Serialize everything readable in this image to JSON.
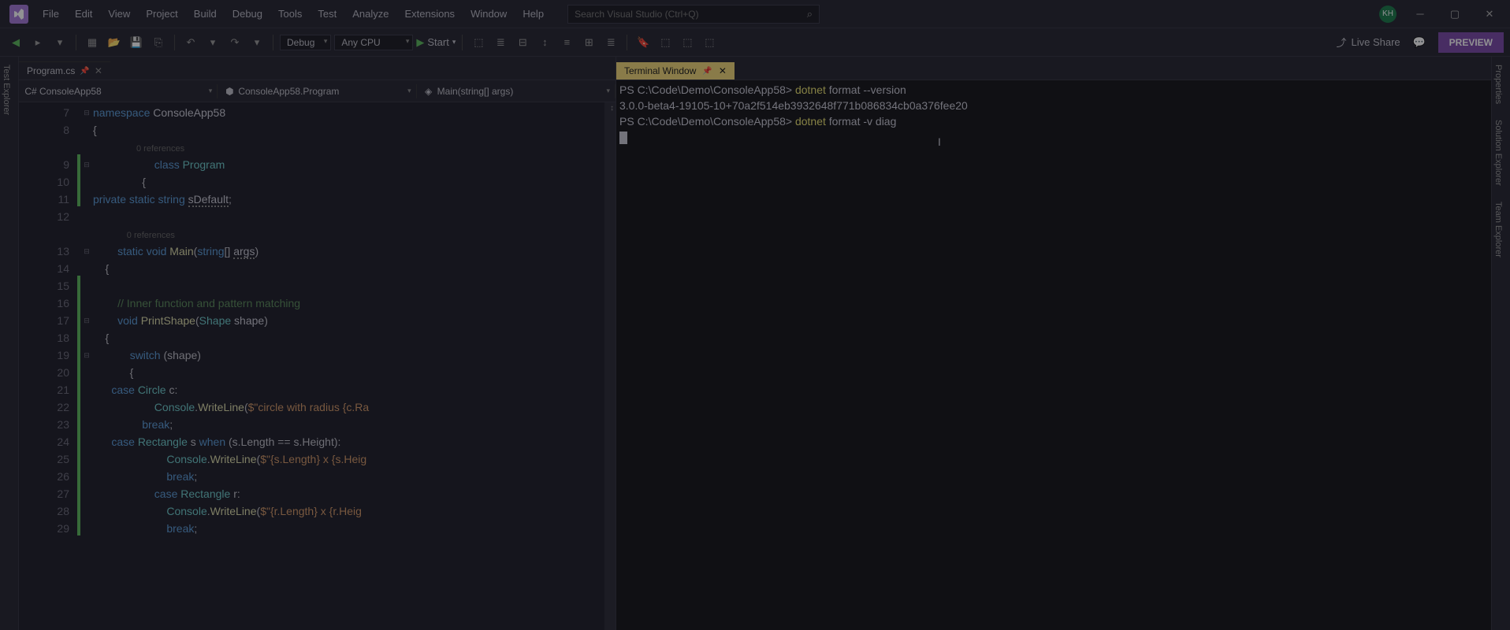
{
  "menu": {
    "items": [
      "File",
      "Edit",
      "View",
      "Project",
      "Build",
      "Debug",
      "Tools",
      "Test",
      "Analyze",
      "Extensions",
      "Window",
      "Help"
    ]
  },
  "search": {
    "placeholder": "Search Visual Studio (Ctrl+Q)"
  },
  "avatar": {
    "initials": "KH"
  },
  "toolbar": {
    "config": "Debug",
    "platform": "Any CPU",
    "start": "Start",
    "live_share": "Live Share",
    "preview": "PREVIEW"
  },
  "side_tabs": {
    "left": "Test Explorer",
    "right": [
      "Properties",
      "Solution Explorer",
      "Team Explorer"
    ]
  },
  "editor": {
    "file_tab": "Program.cs",
    "breadcrumb": {
      "project": "ConsoleApp58",
      "class": "ConsoleApp58.Program",
      "method": "Main(string[] args)"
    },
    "lines": [
      {
        "n": 7,
        "fold": "-",
        "change": false,
        "parts": [
          [
            "kw",
            "namespace"
          ],
          [
            "",
            " "
          ],
          [
            "ident",
            "ConsoleApp58"
          ]
        ]
      },
      {
        "n": 8,
        "change": false,
        "parts": [
          [
            "",
            "{"
          ]
        ]
      },
      {
        "ref": "0 references",
        "indent": 18
      },
      {
        "n": 9,
        "fold": "-",
        "change": true,
        "parts": [
          [
            "",
            "                    "
          ],
          [
            "kw",
            "class"
          ],
          [
            "",
            " "
          ],
          [
            "type",
            "Program"
          ]
        ]
      },
      {
        "n": 10,
        "change": true,
        "parts": [
          [
            "",
            "                {"
          ]
        ]
      },
      {
        "n": 11,
        "change": true,
        "parts": [
          [
            "kw",
            "private"
          ],
          [
            "",
            " "
          ],
          [
            "kw",
            "static"
          ],
          [
            "",
            " "
          ],
          [
            "kw",
            "string"
          ],
          [
            "",
            " "
          ],
          [
            "ident squiggle",
            "sDefault"
          ],
          [
            "",
            ";"
          ]
        ]
      },
      {
        "n": 12,
        "change": false,
        "parts": [
          [
            "",
            " "
          ]
        ]
      },
      {
        "ref": "0 references",
        "indent": 14
      },
      {
        "n": 13,
        "fold": "-",
        "change": false,
        "parts": [
          [
            "",
            "        "
          ],
          [
            "kw",
            "static"
          ],
          [
            "",
            " "
          ],
          [
            "kw",
            "void"
          ],
          [
            "",
            " "
          ],
          [
            "method",
            "Main"
          ],
          [
            "",
            "("
          ],
          [
            "kw",
            "string"
          ],
          [
            "",
            "[] "
          ],
          [
            "ident squiggle",
            "args"
          ],
          [
            "",
            ")"
          ]
        ]
      },
      {
        "n": 14,
        "change": false,
        "parts": [
          [
            "",
            "    {"
          ]
        ]
      },
      {
        "n": 15,
        "change": true,
        "parts": [
          [
            "",
            " "
          ]
        ]
      },
      {
        "n": 16,
        "change": true,
        "parts": [
          [
            "",
            "        "
          ],
          [
            "comment",
            "// Inner function and pattern matching"
          ]
        ]
      },
      {
        "n": 17,
        "fold": "-",
        "change": true,
        "parts": [
          [
            "",
            "        "
          ],
          [
            "kw",
            "void"
          ],
          [
            "",
            " "
          ],
          [
            "method",
            "PrintShape"
          ],
          [
            "",
            "("
          ],
          [
            "type",
            "Shape"
          ],
          [
            "",
            " "
          ],
          [
            "ident",
            "shape"
          ],
          [
            "",
            ")"
          ]
        ]
      },
      {
        "n": 18,
        "change": true,
        "parts": [
          [
            "",
            "    {"
          ]
        ]
      },
      {
        "n": 19,
        "fold": "-",
        "change": true,
        "parts": [
          [
            "",
            "            "
          ],
          [
            "kw",
            "switch"
          ],
          [
            "",
            " (shape)"
          ]
        ]
      },
      {
        "n": 20,
        "change": true,
        "parts": [
          [
            "",
            "            {"
          ]
        ]
      },
      {
        "n": 21,
        "change": true,
        "parts": [
          [
            "",
            "      "
          ],
          [
            "kw",
            "case"
          ],
          [
            "",
            " "
          ],
          [
            "type",
            "Circle"
          ],
          [
            "",
            " c:"
          ]
        ]
      },
      {
        "n": 22,
        "change": true,
        "parts": [
          [
            "",
            "                    "
          ],
          [
            "type",
            "Console"
          ],
          [
            "",
            "."
          ],
          [
            "method",
            "WriteLine"
          ],
          [
            "",
            "("
          ],
          [
            "str",
            "$\"circle with radius {c.Ra"
          ]
        ]
      },
      {
        "n": 23,
        "change": true,
        "parts": [
          [
            "",
            "                "
          ],
          [
            "kw",
            "break"
          ],
          [
            "",
            ";"
          ]
        ]
      },
      {
        "n": 24,
        "change": true,
        "parts": [
          [
            "",
            "      "
          ],
          [
            "kw",
            "case"
          ],
          [
            "",
            " "
          ],
          [
            "type",
            "Rectangle"
          ],
          [
            "",
            " s "
          ],
          [
            "kw",
            "when"
          ],
          [
            "",
            " (s.Length == s.Height):"
          ]
        ]
      },
      {
        "n": 25,
        "change": true,
        "parts": [
          [
            "",
            "                        "
          ],
          [
            "type",
            "Console"
          ],
          [
            "",
            "."
          ],
          [
            "method",
            "WriteLine"
          ],
          [
            "",
            "("
          ],
          [
            "str",
            "$\"{s.Length} x {s.Heig"
          ]
        ]
      },
      {
        "n": 26,
        "change": true,
        "parts": [
          [
            "",
            "                        "
          ],
          [
            "kw",
            "break"
          ],
          [
            "",
            ";"
          ]
        ]
      },
      {
        "n": 27,
        "change": true,
        "parts": [
          [
            "",
            "                    "
          ],
          [
            "kw",
            "case"
          ],
          [
            "",
            " "
          ],
          [
            "type",
            "Rectangle"
          ],
          [
            "",
            " r:"
          ]
        ]
      },
      {
        "n": 28,
        "change": true,
        "parts": [
          [
            "",
            "                        "
          ],
          [
            "type",
            "Console"
          ],
          [
            "",
            "."
          ],
          [
            "method",
            "WriteLine"
          ],
          [
            "",
            "("
          ],
          [
            "str",
            "$\"{r.Length} x {r.Heig"
          ]
        ]
      },
      {
        "n": 29,
        "change": true,
        "parts": [
          [
            "",
            "                        "
          ],
          [
            "kw",
            "break"
          ],
          [
            "",
            ";"
          ]
        ]
      }
    ]
  },
  "terminal": {
    "tab": "Terminal Window",
    "lines": [
      {
        "parts": [
          [
            "ps-prompt",
            "PS C:\\Code\\Demo\\ConsoleApp58> "
          ],
          [
            "cmd-yellow",
            "dotnet"
          ],
          [
            "",
            " format --version"
          ]
        ]
      },
      {
        "parts": [
          [
            "",
            "3.0.0-beta4-19105-10+70a2f514eb3932648f771b086834cb0a376fee20"
          ]
        ]
      },
      {
        "parts": [
          [
            "ps-prompt",
            "PS C:\\Code\\Demo\\ConsoleApp58> "
          ],
          [
            "cmd-yellow",
            "dotnet"
          ],
          [
            "",
            " format -v diag"
          ]
        ]
      }
    ]
  }
}
